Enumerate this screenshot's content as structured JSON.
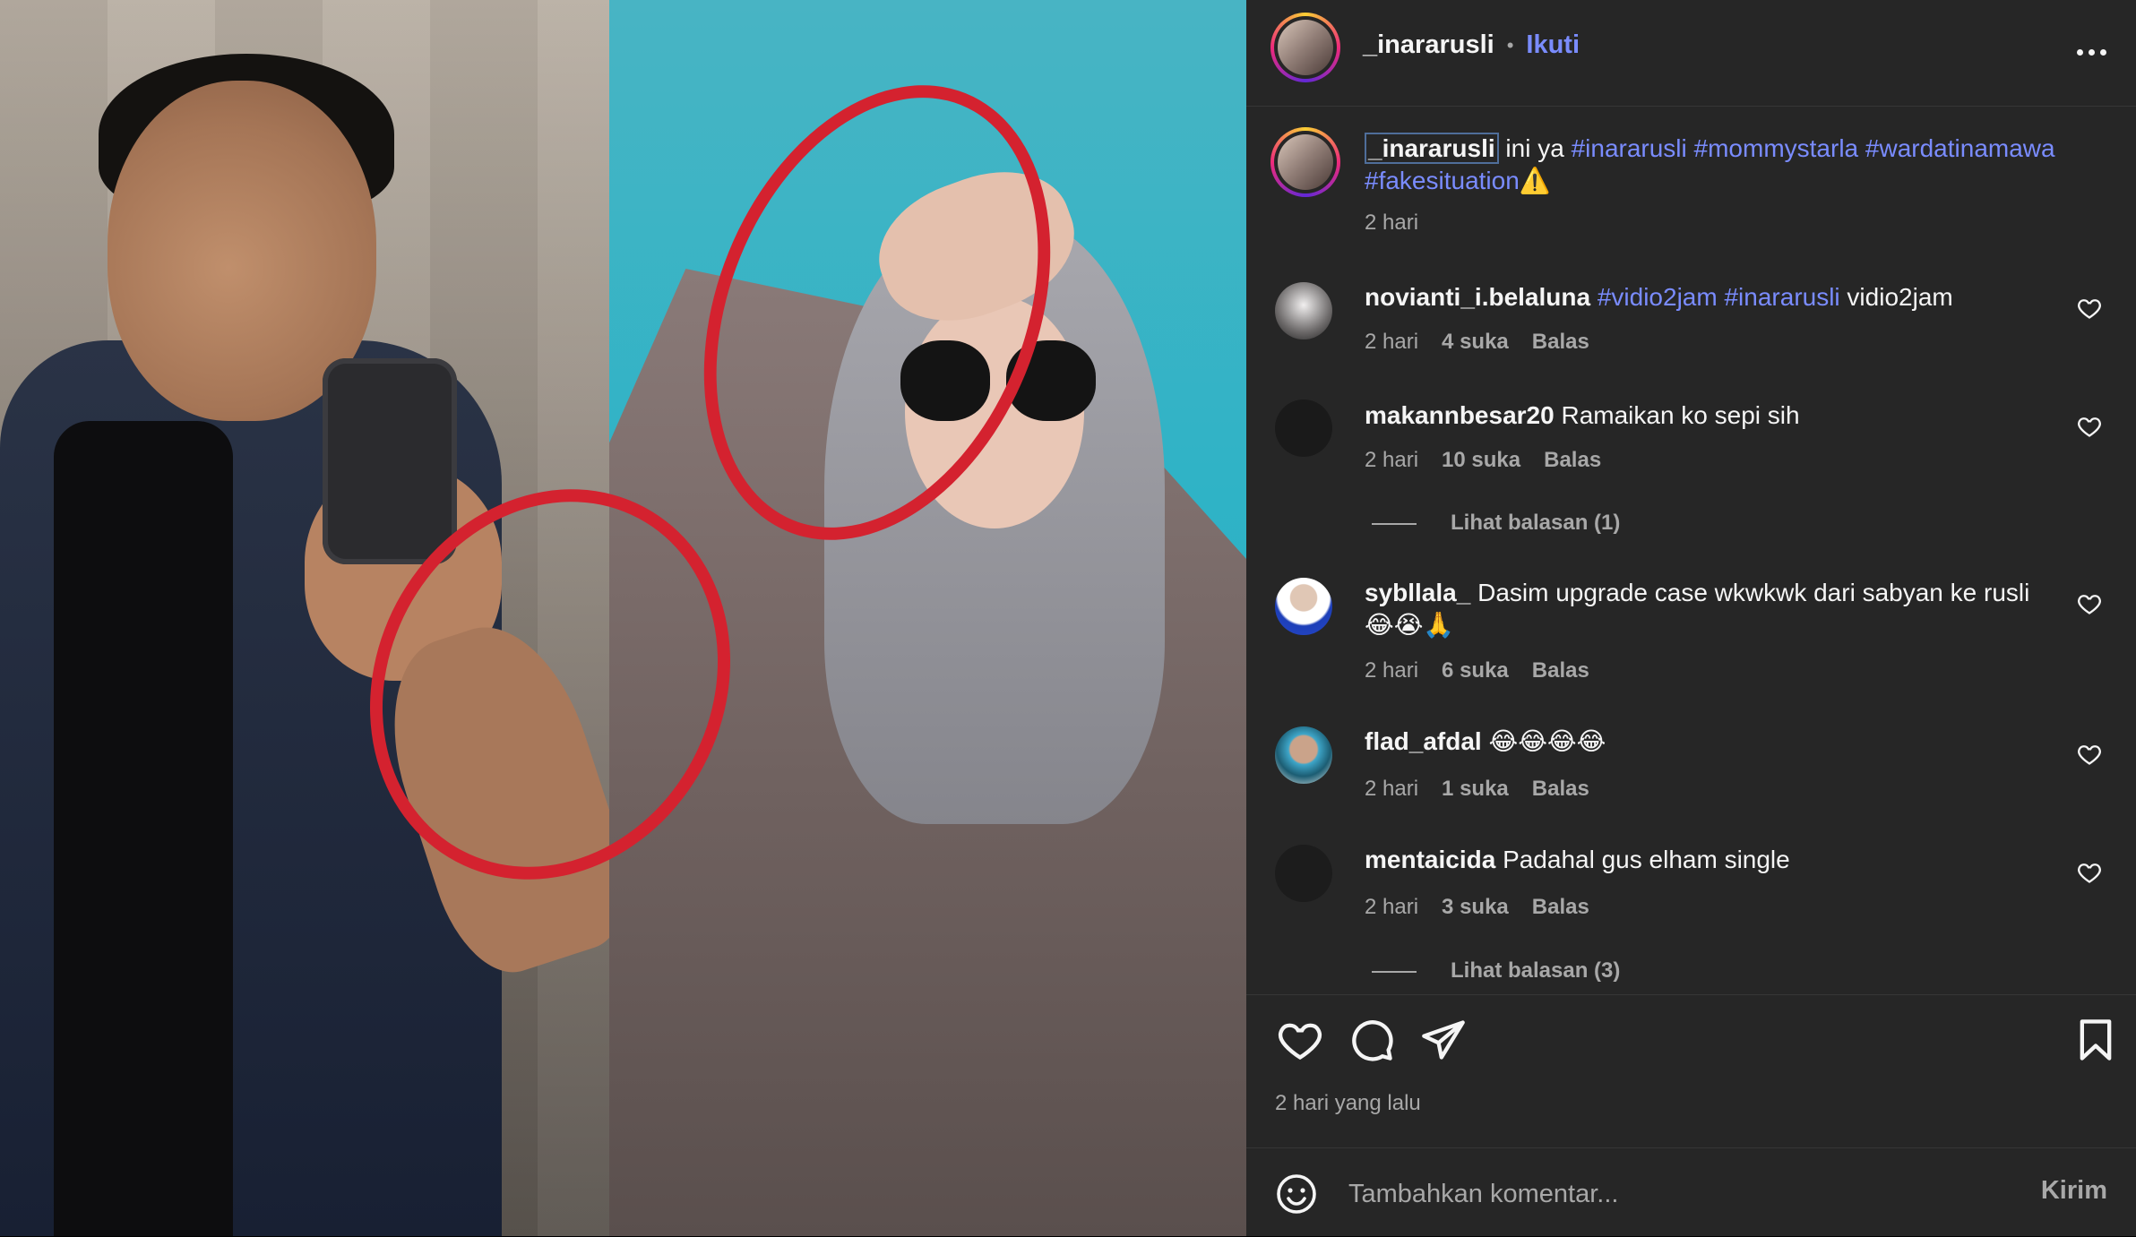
{
  "post": {
    "author": "_inararusli",
    "follow_label": "Ikuti",
    "separator": "•",
    "caption": {
      "username": "_inararusli",
      "text_plain": " ini ya ",
      "tags": [
        "#inararusli",
        "#mommystarla",
        "#wardatinamawa",
        "#fakesituation"
      ],
      "emoji": "⚠️",
      "time": "2 hari"
    }
  },
  "comments": [
    {
      "username": "novianti_i.belaluna",
      "tags": [
        "#vidio2jam",
        "#inararusli"
      ],
      "text": " vidio2jam",
      "time": "2 hari",
      "likes": "4 suka",
      "reply_label": "Balas"
    },
    {
      "username": "makannbesar20",
      "text": "Ramaikan ko sepi sih",
      "time": "2 hari",
      "likes": "10 suka",
      "reply_label": "Balas",
      "view_replies": "Lihat balasan (1)"
    },
    {
      "username": "sybllala_",
      "text": "Dasim upgrade case wkwkwk dari sabyan ke rusli",
      "text2": "😂😭🙏",
      "time": "2 hari",
      "likes": "6 suka",
      "reply_label": "Balas"
    },
    {
      "username": "flad_afdal",
      "text": "😂😂😂😂",
      "time": "2 hari",
      "likes": "1 suka",
      "reply_label": "Balas"
    },
    {
      "username": "mentaicida",
      "text": "Padahal gus elham single",
      "time": "2 hari",
      "likes": "3 suka",
      "reply_label": "Balas",
      "view_replies": "Lihat balasan (3)"
    }
  ],
  "footer": {
    "time_ago": "2 hari yang lalu",
    "comment_placeholder": "Tambahkan komentar...",
    "send_label": "Kirim"
  },
  "colors": {
    "background": "#262626",
    "link": "#7a8cff",
    "muted": "#a8a8a8",
    "highlight": "#d4222f"
  },
  "icons": [
    "more-options-icon",
    "heart-icon",
    "comment-icon",
    "share-icon",
    "bookmark-icon",
    "emoji-icon"
  ]
}
